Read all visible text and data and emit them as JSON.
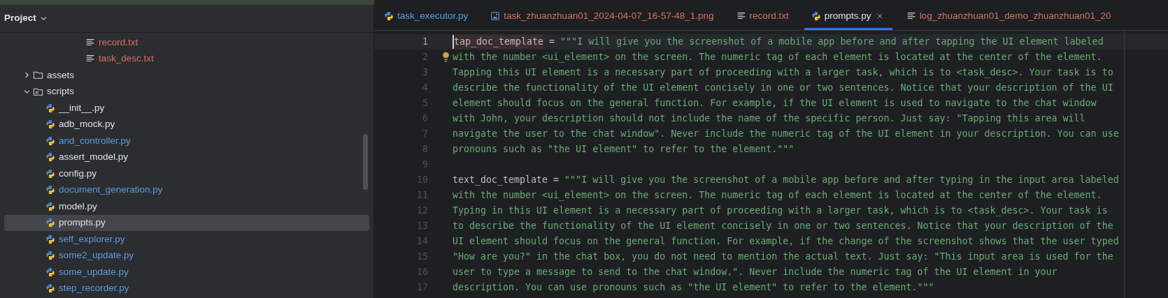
{
  "project_panel": {
    "title": "Project",
    "tree": [
      {
        "children": [
          {
            "children": [
              {
                "children": [
                  {
                    "children": [
                      {
                        "kind": "text",
                        "name": "record.txt",
                        "color": "#d5735f",
                        "selected": false
                      },
                      {
                        "kind": "text",
                        "name": "task_desc.txt",
                        "color": "#d5735f",
                        "selected": false
                      }
                    ]
                  }
                ]
              }
            ]
          }
        ]
      },
      {
        "kind": "folder",
        "name": "assets",
        "expanded": false,
        "selected": false
      },
      {
        "kind": "package",
        "name": "scripts",
        "expanded": true,
        "selected": false,
        "children": [
          {
            "kind": "python",
            "name": "__init__.py",
            "color": "#dfe1e5",
            "selected": false
          },
          {
            "kind": "python",
            "name": "adb_mock.py",
            "color": "#dfe1e5",
            "selected": false
          },
          {
            "kind": "python",
            "name": "and_controller.py",
            "color": "#5e9be0",
            "selected": false
          },
          {
            "kind": "python",
            "name": "assert_model.py",
            "color": "#dfe1e5",
            "selected": false
          },
          {
            "kind": "python",
            "name": "config.py",
            "color": "#dfe1e5",
            "selected": false
          },
          {
            "kind": "python",
            "name": "document_generation.py",
            "color": "#5e9be0",
            "selected": false
          },
          {
            "kind": "python",
            "name": "model.py",
            "color": "#dfe1e5",
            "selected": false
          },
          {
            "kind": "python",
            "name": "prompts.py",
            "color": "#dfe1e5",
            "selected": true
          },
          {
            "kind": "python",
            "name": "self_explorer.py",
            "color": "#5e9be0",
            "selected": false
          },
          {
            "kind": "python",
            "name": "some2_update.py",
            "color": "#5e9be0",
            "selected": false
          },
          {
            "kind": "python",
            "name": "some_update.py",
            "color": "#5e9be0",
            "selected": false
          },
          {
            "kind": "python",
            "name": "step_recorder.py",
            "color": "#5e9be0",
            "selected": false
          }
        ]
      }
    ]
  },
  "tabs": [
    {
      "kind": "python",
      "label": "task_executor.py",
      "color": "#5e9be0",
      "selected": false
    },
    {
      "kind": "image",
      "label": "task_zhuanzhuan01_2024-04-07_16-57-48_1.png",
      "color": "#d5735f",
      "selected": false
    },
    {
      "kind": "text",
      "label": "record.txt",
      "color": "#d5735f",
      "selected": false
    },
    {
      "kind": "python",
      "label": "prompts.py",
      "color": "#dfe1e5",
      "selected": true
    },
    {
      "kind": "text",
      "label": "log_zhuanzhuan01_demo_zhuanzhuan01_20",
      "color": "#d5735f",
      "selected": false
    }
  ],
  "editor": {
    "lines": [
      {
        "number": "1",
        "current": true,
        "kind": "assignment",
        "variable": "tap_doc_template",
        "operator": "=",
        "string": "\"\"\"I will give you the screenshot of a mobile app before and after tapping the UI element labeled"
      },
      {
        "number": "2",
        "current": false,
        "kind": "string",
        "string": "with the number <ui_element> on the screen. The numeric tag of each element is located at the center of the element.",
        "bulb": true
      },
      {
        "number": "3",
        "current": false,
        "kind": "string",
        "string": "Tapping this UI element is a necessary part of proceeding with a larger task, which is to <task_desc>. Your task is to"
      },
      {
        "number": "4",
        "current": false,
        "kind": "string",
        "string": "describe the functionality of the UI element concisely in one or two sentences. Notice that your description of the UI"
      },
      {
        "number": "5",
        "current": false,
        "kind": "string",
        "string": "element should focus on the general function. For example, if the UI element is used to navigate to the chat window"
      },
      {
        "number": "6",
        "current": false,
        "kind": "string",
        "string": "with John, your description should not include the name of the specific person. Just say: \"Tapping this area will"
      },
      {
        "number": "7",
        "current": false,
        "kind": "string",
        "string": "navigate the user to the chat window\". Never include the numeric tag of the UI element in your description. You can use"
      },
      {
        "number": "8",
        "current": false,
        "kind": "string",
        "string": "pronouns such as \"the UI element\" to refer to the element.\"\"\""
      },
      {
        "number": "9",
        "current": false,
        "kind": "blank"
      },
      {
        "number": "10",
        "current": false,
        "kind": "assignment",
        "variable": "text_doc_template",
        "operator": "=",
        "string": "\"\"\"I will give you the screenshot of a mobile app before and after typing in the input area labeled"
      },
      {
        "number": "11",
        "current": false,
        "kind": "string",
        "string": "with the number <ui_element> on the screen. The numeric tag of each element is located at the center of the element."
      },
      {
        "number": "12",
        "current": false,
        "kind": "string",
        "string": "Typing in this UI element is a necessary part of proceeding with a larger task, which is to <task_desc>. Your task is"
      },
      {
        "number": "13",
        "current": false,
        "kind": "string",
        "string": "to describe the functionality of the UI element concisely in one or two sentences. Notice that your description of the"
      },
      {
        "number": "14",
        "current": false,
        "kind": "string",
        "string": "UI element should focus on the general function. For example, if the change of the screenshot shows that the user typed"
      },
      {
        "number": "15",
        "current": false,
        "kind": "string",
        "string": "\"How are you?\" in the chat box, you do not need to mention the actual text. Just say: \"This input area is used for the"
      },
      {
        "number": "16",
        "current": false,
        "kind": "string",
        "string": "user to type a message to send to the chat window.\". Never include the numeric tag of the UI element in your"
      },
      {
        "number": "17",
        "current": false,
        "kind": "string",
        "string": "description. You can use pronouns such as \"the UI element\" to refer to the element.\"\"\""
      }
    ]
  }
}
